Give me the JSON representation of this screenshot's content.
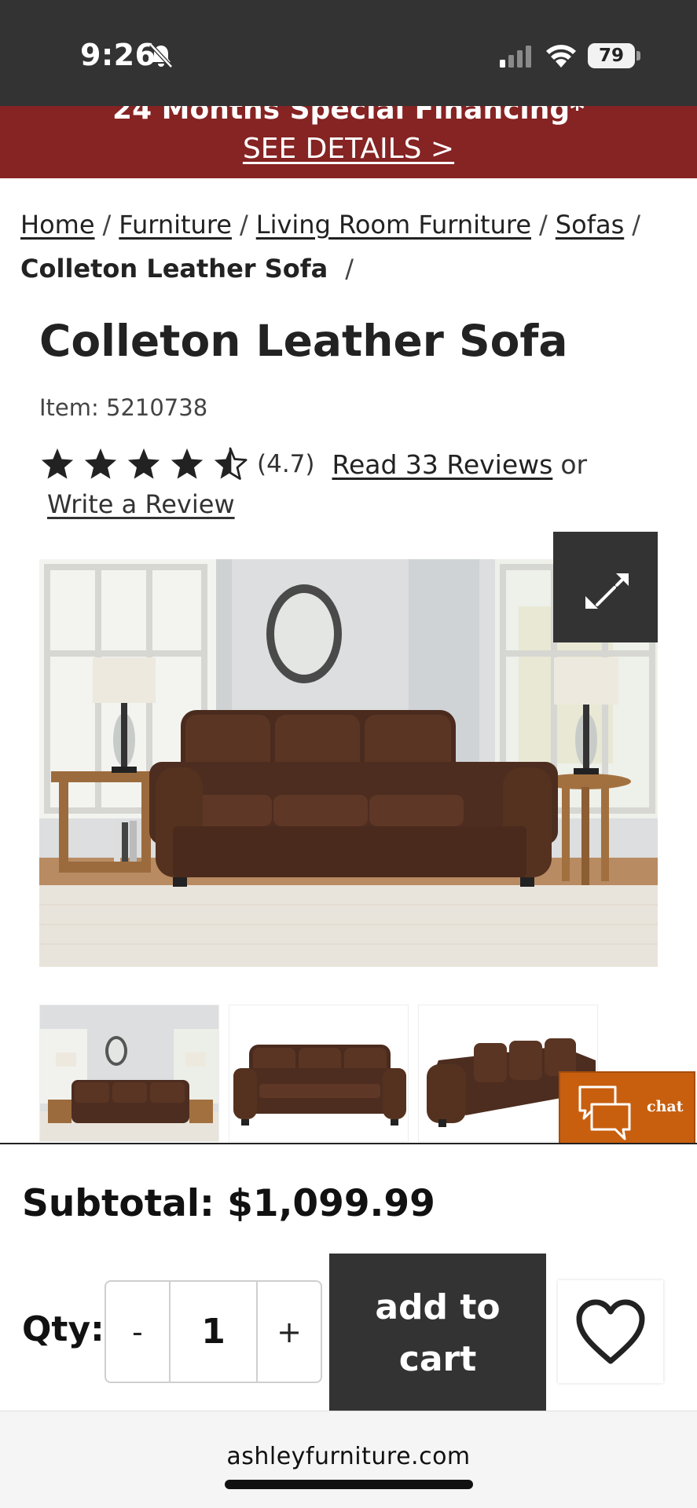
{
  "status_bar": {
    "time": "9:26",
    "battery": "79",
    "icons": [
      "bell-off-icon",
      "signal-icon",
      "wifi-icon",
      "battery-icon"
    ]
  },
  "promo": {
    "title": "24 Months Special Financing*",
    "link": "SEE DETAILS >"
  },
  "breadcrumb": {
    "items": [
      "Home",
      "Furniture",
      "Living Room Furniture",
      "Sofas"
    ],
    "separator": "/",
    "current": "Colleton Leather Sofa"
  },
  "product": {
    "title": "Colleton Leather Sofa",
    "item": "Item: 5210738",
    "rating": 4.7,
    "rating_text": "(4.7)",
    "reviews_link": "Read 33 Reviews",
    "or_text": "or",
    "write_review": "Write a Review"
  },
  "gallery": {
    "thumbnails": [
      "room-scene",
      "front-view",
      "angle-view"
    ]
  },
  "chat": {
    "label": "chat"
  },
  "cart": {
    "subtotal": "Subtotal: $1,099.99",
    "qty_label": "Qty:",
    "minus": "-",
    "qty": "1",
    "plus": "+",
    "add_to_cart_line1": "add to",
    "add_to_cart_line2": "cart"
  },
  "browser": {
    "url": "ashleyfurniture.com"
  },
  "colors": {
    "banner": "#862323",
    "dark": "#333333",
    "chat": "#c85f0f"
  }
}
